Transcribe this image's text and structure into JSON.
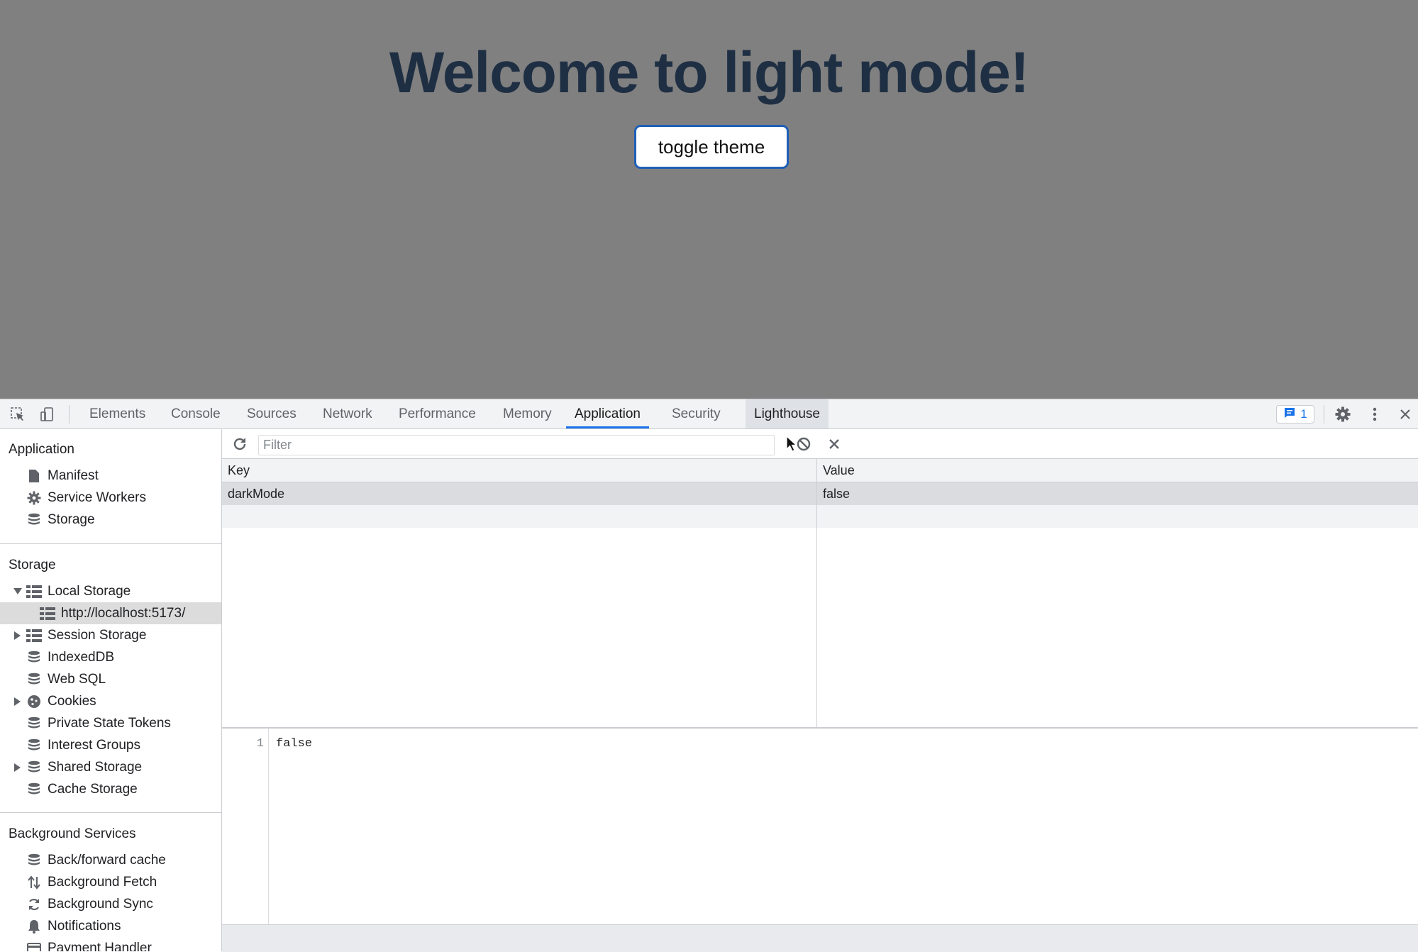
{
  "page": {
    "heading": "Welcome to light mode!",
    "toggle_label": "toggle theme"
  },
  "devtools": {
    "tabs": [
      "Elements",
      "Console",
      "Sources",
      "Network",
      "Performance",
      "Memory",
      "Application",
      "Security",
      "Lighthouse"
    ],
    "active_tab": "Application",
    "issues_count": "1",
    "sidebar": {
      "application_header": "Application",
      "application_items": [
        "Manifest",
        "Service Workers",
        "Storage"
      ],
      "storage_header": "Storage",
      "storage_items": [
        "Local Storage",
        "http://localhost:5173/",
        "Session Storage",
        "IndexedDB",
        "Web SQL",
        "Cookies",
        "Private State Tokens",
        "Interest Groups",
        "Shared Storage",
        "Cache Storage"
      ],
      "background_header": "Background Services",
      "background_items": [
        "Back/forward cache",
        "Background Fetch",
        "Background Sync",
        "Notifications",
        "Payment Handler"
      ]
    },
    "toolbar": {
      "filter_placeholder": "Filter"
    },
    "table": {
      "headers": [
        "Key",
        "Value"
      ],
      "rows": [
        {
          "key": "darkMode",
          "value": "false"
        }
      ]
    },
    "preview": {
      "line_number": "1",
      "content": "false"
    }
  },
  "colors": {
    "page_background": "#808080",
    "heading_color": "#1f2f43",
    "accent": "#1a73e8"
  }
}
